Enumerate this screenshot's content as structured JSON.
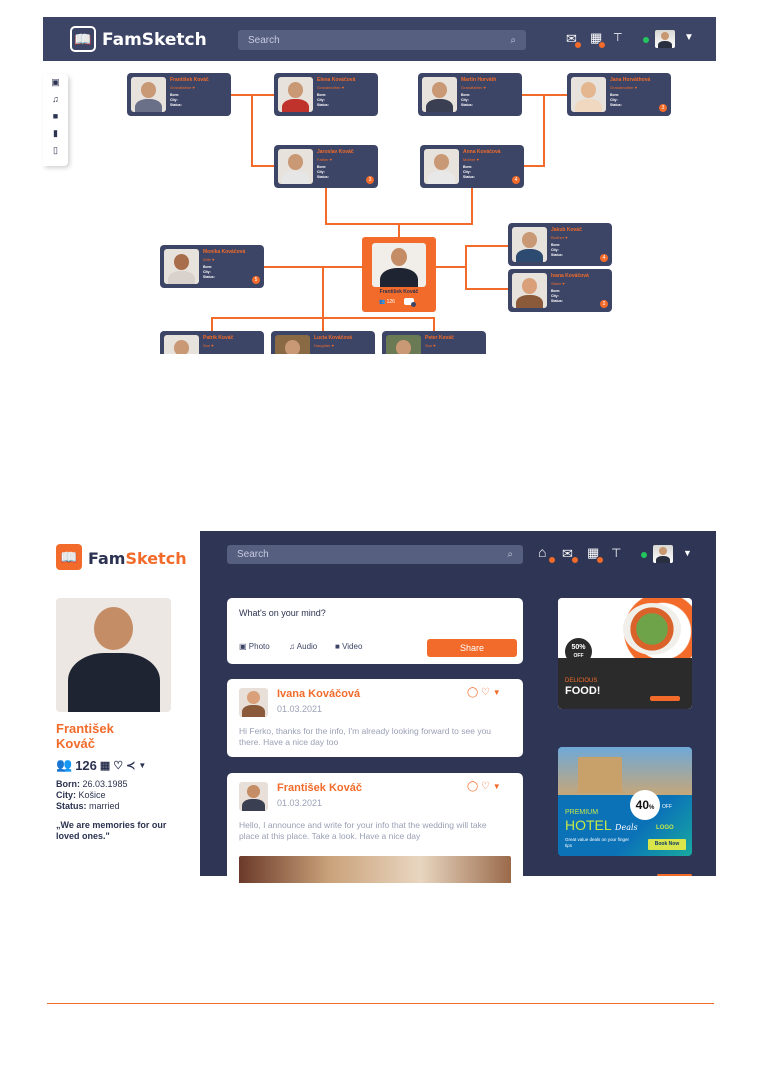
{
  "brand": {
    "name": "FamSketch",
    "name_part1": "Fam",
    "name_part2": "Sketch"
  },
  "colors": {
    "accent": "#f26b2a",
    "navy": "#3d4566",
    "panel": "#2e3555"
  },
  "top": {
    "search_placeholder": "Search",
    "icons": [
      "mail-icon",
      "calendar-icon",
      "tree-icon"
    ]
  },
  "left_toolbar": {
    "icons": [
      "image-icon",
      "music-icon",
      "video-icon",
      "book-icon",
      "notebook-icon"
    ]
  },
  "tree": {
    "people": [
      {
        "name": "František Kováč",
        "rel": "Grandfather"
      },
      {
        "name": "Elena Kováčová",
        "rel": "Grandmother"
      },
      {
        "name": "Martin Horváth",
        "rel": "Grandfather"
      },
      {
        "name": "Jana Horváthová",
        "rel": "Grandmother"
      },
      {
        "name": "Jaroslav Kováč",
        "rel": "Father"
      },
      {
        "name": "Anna Kováčová",
        "rel": "Mother"
      },
      {
        "name": "Monika Kováčová",
        "rel": "Wife"
      },
      {
        "name": "Jakub Kováč",
        "rel": "Brother"
      },
      {
        "name": "Ivana Kováčová",
        "rel": "Sister"
      },
      {
        "name": "Patrik Kováč",
        "rel": "Son"
      },
      {
        "name": "Lucia Kováčová",
        "rel": "Daughter"
      },
      {
        "name": "Peter Kováč",
        "rel": "Son"
      }
    ],
    "detail_labels": {
      "born": "Born:",
      "city": "City:",
      "status": "Status:"
    },
    "badges": [
      "3",
      "4",
      "5",
      "4",
      "2"
    ],
    "center": {
      "name": "František Kováč",
      "count": "126"
    }
  },
  "profile": {
    "first_name": "František",
    "last_name": "Kováč",
    "followers": "126",
    "born_label": "Born:",
    "born": "26.03.1985",
    "city_label": "City:",
    "city": "Košice",
    "status_label": "Status:",
    "status": "married",
    "quote": "„We are memories for our loved ones.\""
  },
  "composer": {
    "prompt": "What's on your mind?",
    "photo": "Photo",
    "audio": "Audio",
    "video": "Video",
    "share": "Share"
  },
  "posts": [
    {
      "author": "Ivana Kováčová",
      "date": "01.03.2021",
      "text": "Hi Ferko, thanks for the info, I'm already looking forward to see you there. Have a nice day too"
    },
    {
      "author": "František Kováč",
      "date": "01.03.2021",
      "text": "Hello, I announce and write for your info that the wedding will take place at this place. Take a look. Have a nice day"
    }
  ],
  "ads": {
    "food": {
      "discount": "50%",
      "off": "OFF",
      "line1": "DELICIOUS",
      "line2": "FOOD!"
    },
    "hotel": {
      "line1": "PREMIUM",
      "line2": "HOTEL",
      "script": "Deals",
      "discount": "40",
      "pct": "%",
      "off": "OFF",
      "logo": "LOGO",
      "sub": "Great value deals on your finger tips",
      "cta": "Book Now"
    }
  }
}
